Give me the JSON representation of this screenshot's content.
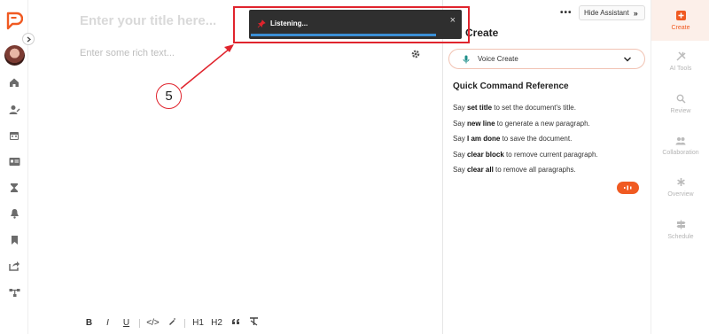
{
  "editor": {
    "title_placeholder": "Enter your title here...",
    "body_placeholder": "Enter some rich text...",
    "format_buttons": [
      "B",
      "I",
      "U",
      "</>",
      "H1",
      "H2"
    ]
  },
  "toast": {
    "message": "Listening...",
    "close_label": "×"
  },
  "annotation": {
    "step_number": "5"
  },
  "assistant": {
    "more_label": "•••",
    "hide_label": "Hide Assistant",
    "hide_chevron": "»",
    "title": "Create",
    "voice_select_value": "Voice Create",
    "qcr_title": "Quick Command Reference",
    "commands": [
      {
        "pre": "Say ",
        "cmd": "set title",
        "post": " to set the document's title."
      },
      {
        "pre": "Say ",
        "cmd": "new line",
        "post": " to generate a new paragraph."
      },
      {
        "pre": "Say ",
        "cmd": "I am done",
        "post": " to save the document."
      },
      {
        "pre": "Say ",
        "cmd": "clear block",
        "post": " to remove current paragraph."
      },
      {
        "pre": "Say ",
        "cmd": "clear all",
        "post": " to remove all paragraphs."
      }
    ]
  },
  "rail": {
    "items": [
      {
        "label": "Create",
        "icon": "plus-square-icon"
      },
      {
        "label": "AI Tools",
        "icon": "tools-icon"
      },
      {
        "label": "Review",
        "icon": "search-icon"
      },
      {
        "label": "Collaboration",
        "icon": "users-icon"
      },
      {
        "label": "Overview",
        "icon": "asterisk-icon"
      },
      {
        "label": "Schedule",
        "icon": "signpost-icon"
      }
    ]
  },
  "colors": {
    "accent": "#f05a22",
    "annotation_red": "#e0242d",
    "toast_bg": "#2f2f2f",
    "progress": "#3b8fd6"
  }
}
